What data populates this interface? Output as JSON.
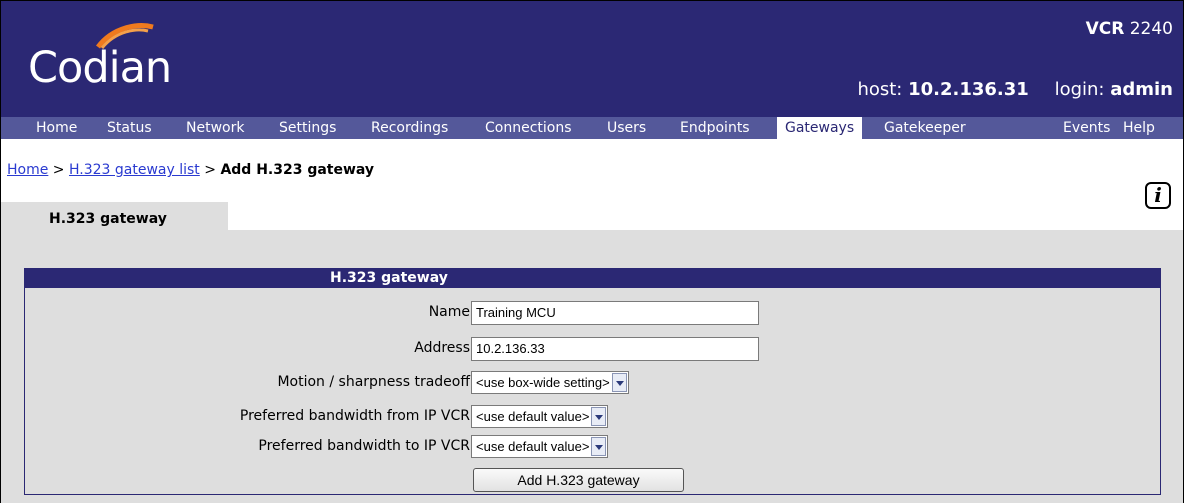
{
  "header": {
    "brand": "Codian",
    "product_prefix": "VCR",
    "product_model": "2240",
    "host_label": "host:",
    "host_value": "10.2.136.31",
    "login_label": "login:",
    "login_value": "admin",
    "background_color": "#2b2874",
    "logo_swoosh_color": "#f07a1e"
  },
  "nav": {
    "items": [
      {
        "label": "Home"
      },
      {
        "label": "Status"
      },
      {
        "label": "Network"
      },
      {
        "label": "Settings"
      },
      {
        "label": "Recordings"
      },
      {
        "label": "Connections"
      },
      {
        "label": "Users"
      },
      {
        "label": "Endpoints"
      },
      {
        "label": "Gateways"
      },
      {
        "label": "Gatekeeper"
      },
      {
        "label": "Events"
      },
      {
        "label": "Help"
      }
    ],
    "active": "Gateways"
  },
  "breadcrumb": {
    "home": "Home",
    "sep1": ">",
    "list": "H.323 gateway list",
    "sep2": ">",
    "current": "Add H.323 gateway"
  },
  "tab": {
    "label": "H.323 gateway"
  },
  "form": {
    "title": "H.323 gateway",
    "name_label": "Name",
    "name_value": "Training MCU",
    "address_label": "Address",
    "address_value": "10.2.136.33",
    "motion_label": "Motion / sharpness tradeoff",
    "motion_value": "<use box-wide setting>",
    "bw_from_label": "Preferred bandwidth from IP VCR",
    "bw_from_value": "<use default value>",
    "bw_to_label": "Preferred bandwidth to IP VCR",
    "bw_to_value": "<use default value>",
    "submit_label": "Add H.323 gateway"
  },
  "icons": {
    "help": "info-icon",
    "select_arrow": "chevron-down-icon",
    "logo": "codian-swoosh-icon"
  }
}
